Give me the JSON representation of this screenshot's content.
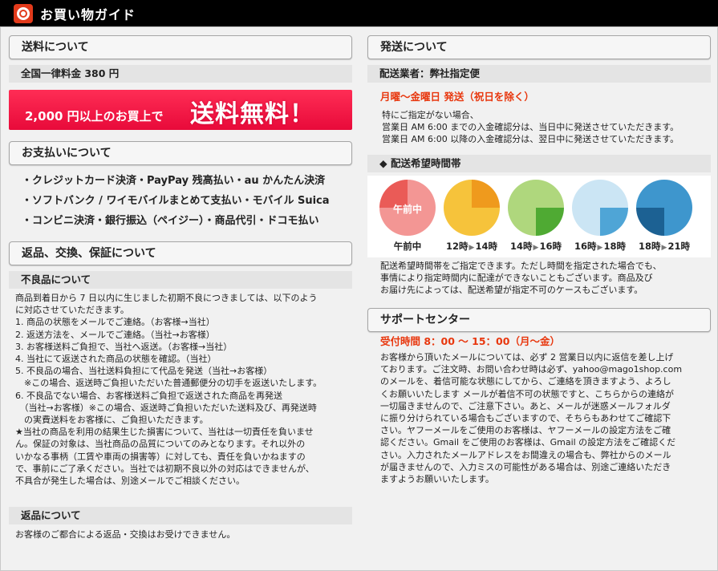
{
  "header": {
    "title": "お買い物ガイド"
  },
  "shipping_fee": {
    "heading": "送料について",
    "subheading": "全国一律料金 380 円",
    "banner_small": "2,000 円以上のお買上で",
    "banner_big": "送料無料！"
  },
  "payment": {
    "heading": "お支払いについて",
    "lines": [
      "・クレジットカード決済・PayPay 残高払い・au かんたん決済",
      "・ソフトバンク / ワイモバイルまとめて支払い・モバイル Suica",
      "・コンビニ決済・銀行振込（ペイジー）・商品代引・ドコモ払い"
    ]
  },
  "returns": {
    "heading": "返品、交換、保証について",
    "defect_heading": "不良品について",
    "defect_lines": [
      "商品到着日から 7 日以内に生じました初期不良につきましては、以下のよう",
      "に対応させていただきます。",
      "1. 商品の状態をメールでご連絡。（お客様→当社）",
      "2. 返送方法を、メールでご連絡。（当社→お客様）",
      "3. お客様送料ご負担で、当社へ返送。（お客様→当社）",
      "4. 当社にて返送された商品の状態を確認。（当社）",
      "5. 不良品の場合、当社送料負担にて代品を発送（当社→お客様）",
      "　※この場合、返送時ご負担いただいた普通郵便分の切手を返送いたします。",
      "6. 不良品でない場合、お客様送料ご負担で返送された商品を再発送",
      "　（当社→お客様）※この場合、返送時ご負担いただいた送料及び、再発送時",
      "　の実費送料をお客様に、ご負担いただきます。",
      "★当社の商品を利用の結果生じた損害について、当社は一切責任を負いませ",
      "ん。保証の対象は、当社商品の品質についてのみとなります。それ以外の",
      "いかなる事柄（工賃や車両の損害等）に対しても、責任を負いかねますの",
      "で、事前にご了承ください。当社では初期不良以外の対応はできませんが、",
      "不具合が発生した場合は、別途メールでご相談ください。"
    ],
    "return_heading": "返品について",
    "return_text": "お客様のご都合による返品・交換はお受けできません。"
  },
  "delivery": {
    "heading": "発送について",
    "carrier": "配送業者：弊社指定便",
    "days": "月曜〜金曜日 発送（祝日を除く）",
    "notes": [
      "特にご指定がない場合、",
      "営業日 AM 6:00 までの入金確認分は、当日中に発送させていただきます。",
      "営業日 AM 6:00 以降の入金確認分は、翌日中に発送させていただきます。"
    ],
    "time_heading": "◆ 配送希望時間帯",
    "slots": [
      {
        "label": "午前中",
        "inner": "午前中",
        "color": "#f39694",
        "accent": "#ea5b57",
        "fraction": 0.25
      },
      {
        "from": "12時",
        "to": "14時",
        "color": "#f6c33b",
        "accent": "#ef9a1d",
        "fraction": 0.25
      },
      {
        "from": "14時",
        "to": "16時",
        "color": "#afd77d",
        "accent": "#4faa33",
        "fraction": 0.25
      },
      {
        "from": "16時",
        "to": "18時",
        "color": "#cbe5f4",
        "accent": "#4fa5d6",
        "fraction": 0.25
      },
      {
        "from": "18時",
        "to": "21時",
        "color": "#3e96cd",
        "accent": "#1c6193",
        "fraction": 0.25
      }
    ],
    "slot_arrow": "▶",
    "time_notes": [
      "配送希望時間帯をご指定できます。ただし時間を指定された場合でも、",
      "事情により指定時間内に配達ができないこともございます。商品及び",
      "お届け先によっては、配送希望が指定不可のケースもございます。"
    ]
  },
  "support": {
    "heading": "サポートセンター",
    "hours": "受付時間 8：00 〜 15：00（月〜金）",
    "lines": [
      "お客様から頂いたメールについては、必ず 2 営業日以内に返信を差し上げ",
      "ております。ご注文時、お問い合わせ時は必ず、yahoo@mago1shop.com",
      "のメールを、着信可能な状態にしてから、ご連絡を頂きますよう、よろし",
      "くお願いいたします メールが着信不可の状態ですと、こちらからの連絡が",
      "一切届きませんので、ご注意下さい。あと、メールが迷惑メールフォルダ",
      "に振り分けられている場合もございますので、そちらもあわせてご確認下",
      "さい。ヤフーメールをご使用のお客様は、ヤフーメールの設定方法をご確",
      "認ください。Gmail をご使用のお客様は、Gmail の設定方法をご確認くだ",
      "さい。入力されたメールアドレスをお間違えの場合も、弊社からのメール",
      "が届きませんので、入力ミスの可能性がある場合は、別途ご連絡いただき",
      "ますようお願いいたします。"
    ]
  }
}
